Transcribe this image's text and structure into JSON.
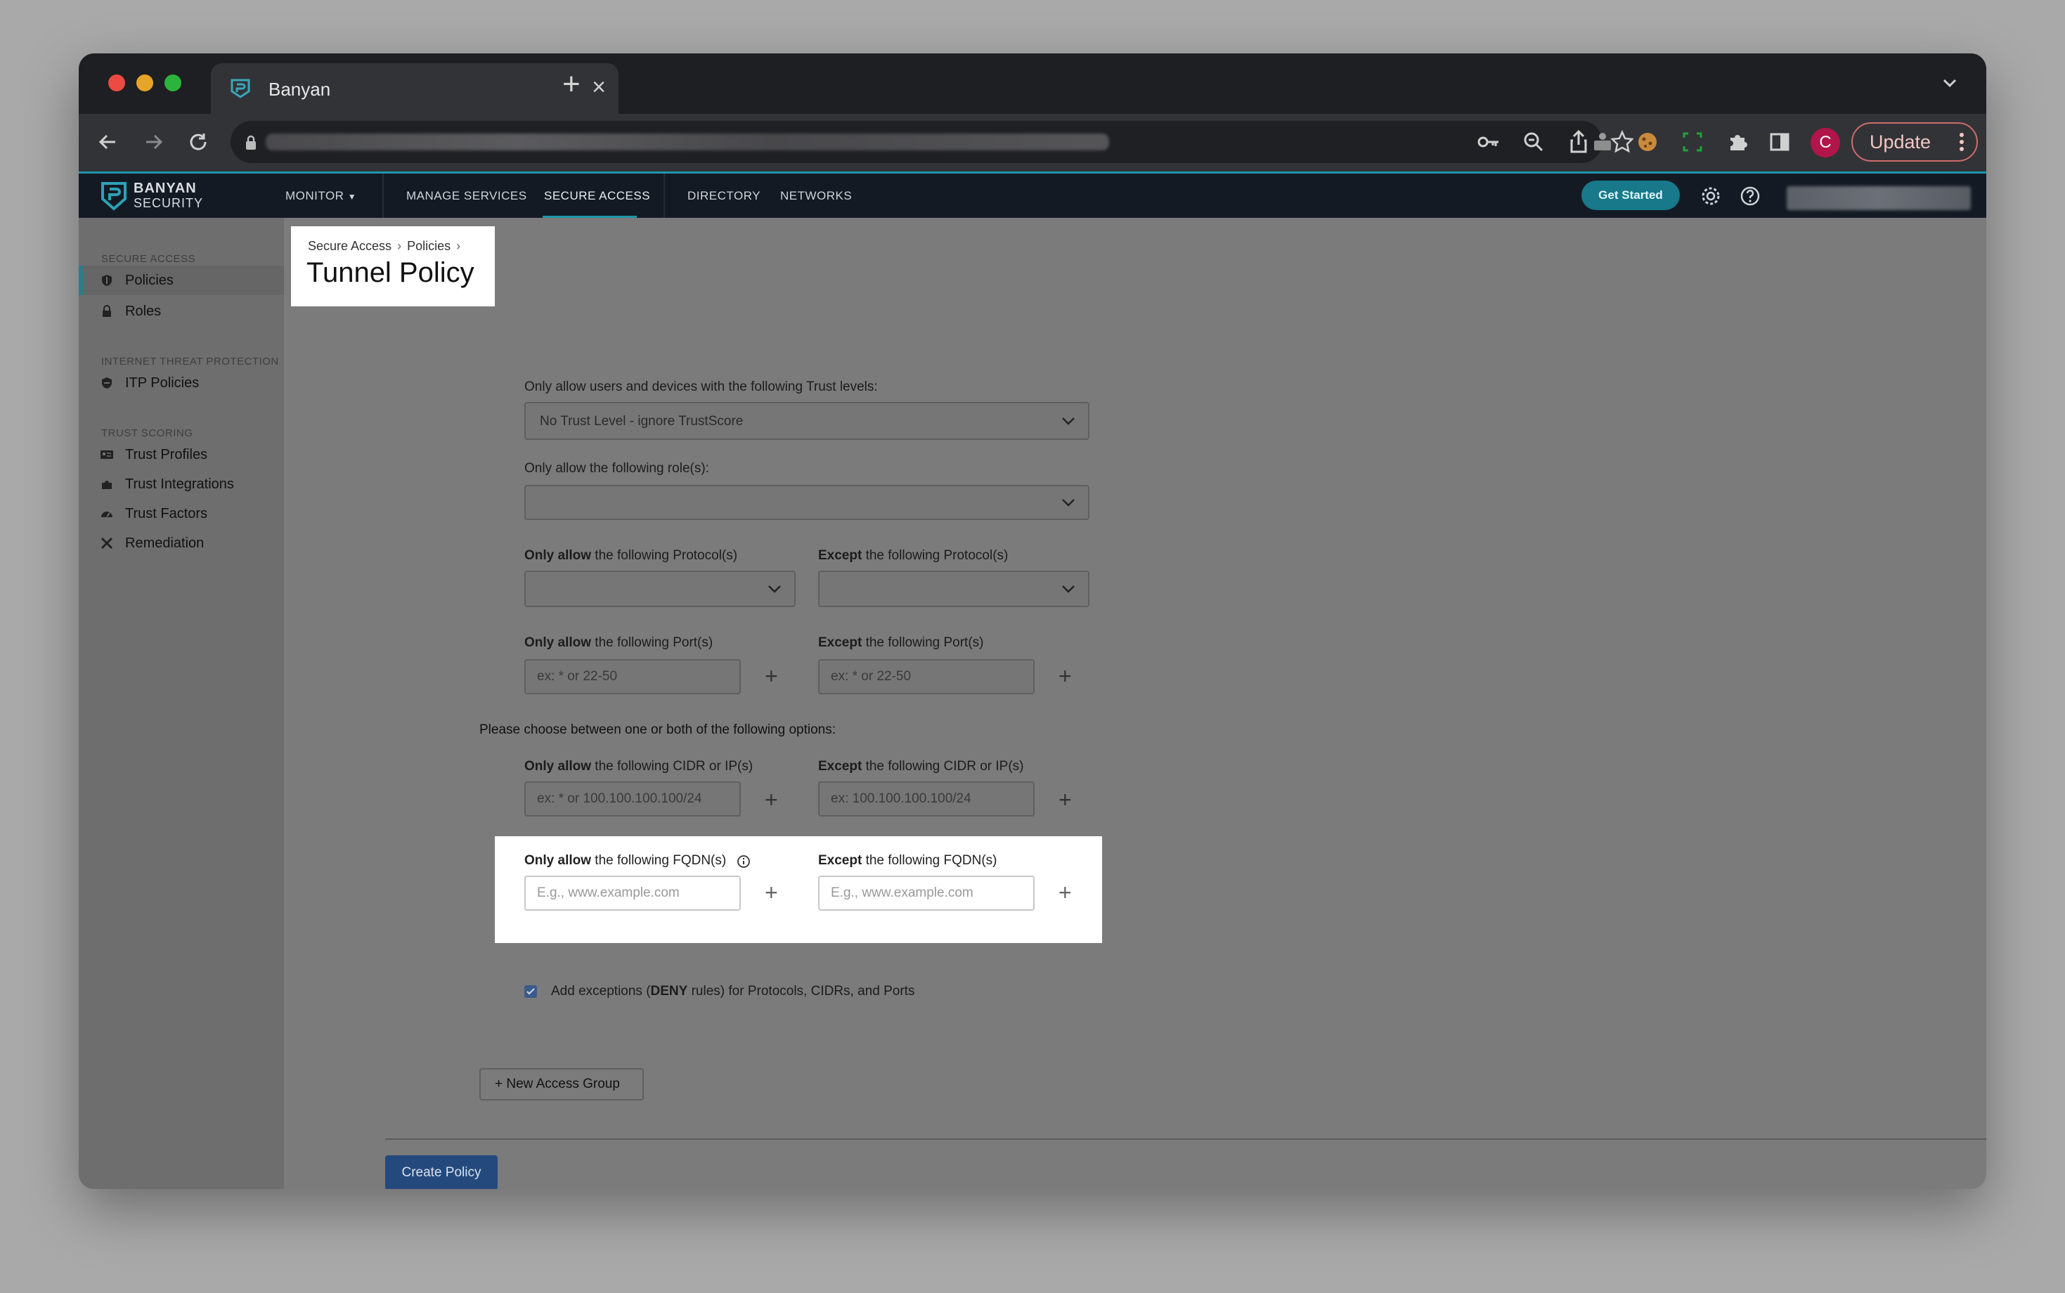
{
  "browser": {
    "tab_title": "Banyan",
    "update_label": "Update",
    "avatar_initial": "C"
  },
  "app": {
    "brand_line1": "BANYAN",
    "brand_line2": "SECURITY",
    "nav": [
      "MONITOR",
      "MANAGE SERVICES",
      "SECURE ACCESS",
      "DIRECTORY",
      "NETWORKS"
    ],
    "get_started": "Get Started",
    "accent_color": "#1c97a9"
  },
  "sidebar": {
    "sections": [
      {
        "title": "SECURE ACCESS",
        "items": [
          {
            "label": "Policies",
            "icon": "shield-icon"
          },
          {
            "label": "Roles",
            "icon": "lock-icon"
          }
        ]
      },
      {
        "title": "INTERNET THREAT PROTECTION",
        "items": [
          {
            "label": "ITP Policies",
            "icon": "shield-icon"
          }
        ]
      },
      {
        "title": "TRUST SCORING",
        "items": [
          {
            "label": "Trust Profiles",
            "icon": "id-card-icon"
          },
          {
            "label": "Trust Integrations",
            "icon": "puzzle-icon"
          },
          {
            "label": "Trust Factors",
            "icon": "gauge-icon"
          },
          {
            "label": "Remediation",
            "icon": "tools-icon"
          }
        ]
      }
    ]
  },
  "page": {
    "breadcrumb": [
      "Secure Access",
      "Policies"
    ],
    "title": "Tunnel Policy"
  },
  "form": {
    "trust_label": "Only allow users and devices with the following Trust levels:",
    "trust_value": "No Trust Level - ignore TrustScore",
    "roles_label": "Only allow the following role(s):",
    "protocol_allow_bold": "Only allow",
    "protocol_allow_rest": " the following Protocol(s)",
    "protocol_except_bold": "Except",
    "protocol_except_rest": " the following Protocol(s)",
    "port_allow_bold": "Only allow",
    "port_allow_rest": " the following Port(s)",
    "port_except_bold": "Except",
    "port_except_rest": " the following Port(s)",
    "port_placeholder": "ex: * or 22-50",
    "options_text": "Please choose between one or both of the following options:",
    "cidr_allow_bold": "Only allow",
    "cidr_allow_rest": " the following CIDR or IP(s)",
    "cidr_except_bold": "Except",
    "cidr_except_rest": " the following CIDR or IP(s)",
    "cidr_allow_placeholder": "ex: * or 100.100.100.100/24",
    "cidr_except_placeholder": "ex: 100.100.100.100/24",
    "fqdn_allow_bold": "Only allow",
    "fqdn_allow_rest": " the following FQDN(s)",
    "fqdn_except_bold": "Except",
    "fqdn_except_rest": " the following FQDN(s)",
    "fqdn_placeholder": "E.g., www.example.com",
    "exceptions_pre": "Add exceptions (",
    "exceptions_bold": "DENY",
    "exceptions_post": " rules) for Protocols, CIDRs, and Ports",
    "new_group": "New Access Group",
    "create": "Create Policy"
  }
}
